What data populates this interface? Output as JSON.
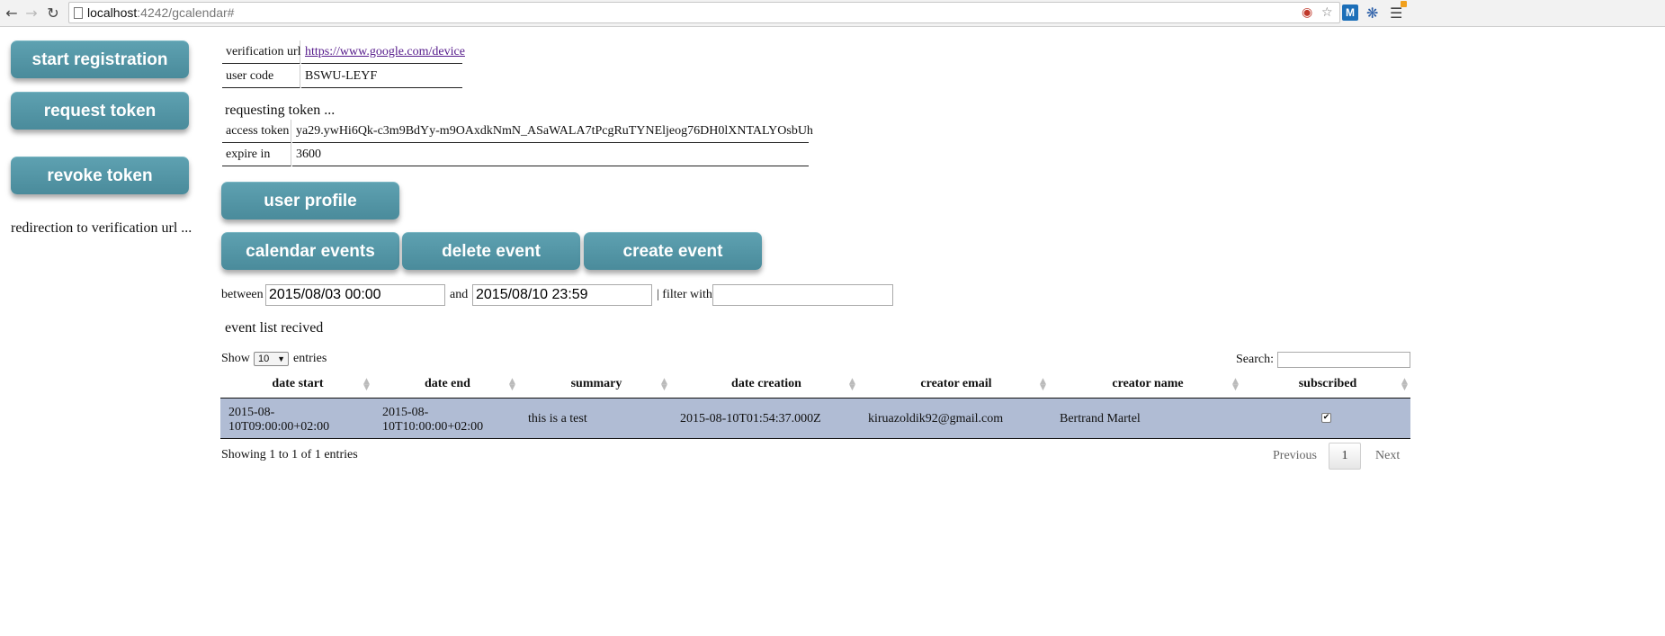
{
  "browser": {
    "url_host": "localhost",
    "url_path": ":4242/gcalendar#",
    "back_icon": "back-arrow-icon",
    "forward_icon": "forward-arrow-icon",
    "reload_icon": "reload-icon",
    "extension_m_label": "M"
  },
  "sidebar": {
    "start_registration": "start registration",
    "request_token": "request token",
    "revoke_token": "revoke token",
    "status_text": "redirection to verification url ..."
  },
  "registration": {
    "verification_url_key": "verification url",
    "verification_url_value": "https://www.google.com/device",
    "user_code_key": "user code",
    "user_code_value": "BSWU-LEYF"
  },
  "token": {
    "status": "requesting token ...",
    "access_token_key": "access token",
    "access_token_value": "ya29.ywHi6Qk-c3m9BdYy-m9OAxdkNmN_ASaWALA7tPcgRuTYNEljeog76DH0lXNTALYOsbUh",
    "expire_key": "expire in",
    "expire_value": "3600"
  },
  "actions": {
    "user_profile": "user profile",
    "calendar_events": "calendar events",
    "delete_event": "delete event",
    "create_event": "create event"
  },
  "filter": {
    "between_label": "between",
    "start_value": "2015/08/03 00:00",
    "and_label": "and",
    "end_value": "2015/08/10 23:59",
    "filter_label": "| filter with",
    "filter_value": ""
  },
  "events": {
    "status": "event list recived",
    "show_label": "Show",
    "entries_label": "entries",
    "page_size": "10",
    "search_label": "Search:",
    "search_value": "",
    "columns": [
      "date start",
      "date end",
      "summary",
      "date creation",
      "creator email",
      "creator name",
      "subscribed"
    ],
    "rows": [
      {
        "date_start_1": "2015-08-",
        "date_start_2": "10T09:00:00+02:00",
        "date_end_1": "2015-08-",
        "date_end_2": "10T10:00:00+02:00",
        "summary": "this is a test",
        "date_creation": "2015-08-10T01:54:37.000Z",
        "creator_email": "kiruazoldik92@gmail.com",
        "creator_name": "Bertrand Martel",
        "subscribed_mark": "✔"
      }
    ],
    "info": "Showing 1 to 1 of 1 entries",
    "previous_label": "Previous",
    "current_page": "1",
    "next_label": "Next"
  }
}
